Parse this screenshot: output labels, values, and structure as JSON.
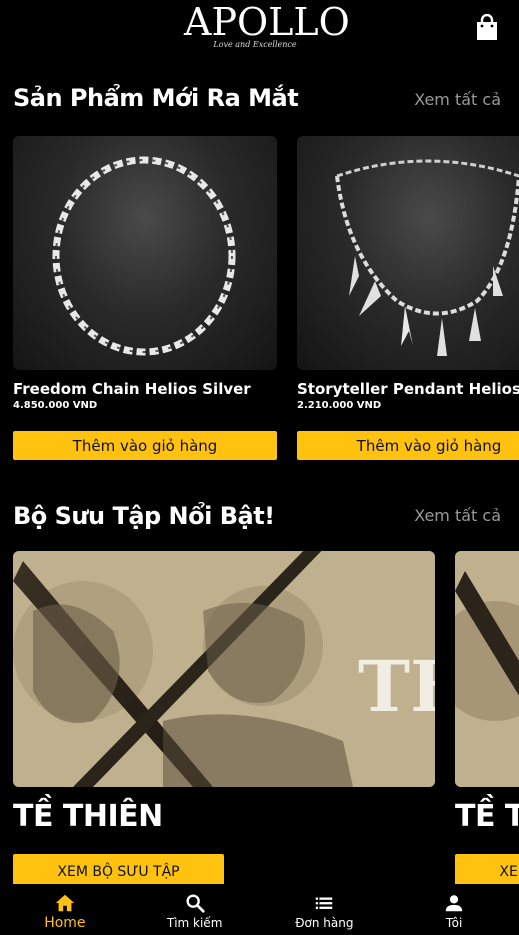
{
  "brand": {
    "name": "APOLLO",
    "tagline": "Love and Excellence"
  },
  "new_products": {
    "title": "Sản Phẩm Mới Ra Mắt",
    "see_all": "Xem tất cả",
    "items": [
      {
        "name": "Freedom Chain Helios Silver",
        "price": "4.850.000 VND",
        "button": "Thêm vào giỏ hàng"
      },
      {
        "name": "Storyteller Pendant Helios Silver",
        "price": "2.210.000 VND",
        "button": "Thêm vào giỏ hàng"
      }
    ]
  },
  "collections": {
    "title": "Bộ Sưu Tập Nổi Bật!",
    "see_all": "Xem tất cả",
    "items": [
      {
        "name": "TỀ THIÊN",
        "button": "XEM BỘ SƯU TẬP",
        "art_text": "TH"
      },
      {
        "name": "TỀ THIÊN",
        "button": "XEM BỘ SƯU TẬP"
      }
    ]
  },
  "bottom_nav": {
    "items": [
      {
        "label": "Home",
        "icon": "home-icon",
        "active": true
      },
      {
        "label": "Tìm kiếm",
        "icon": "search-icon",
        "active": false
      },
      {
        "label": "Đơn hàng",
        "icon": "list-icon",
        "active": false
      },
      {
        "label": "Tôi",
        "icon": "person-icon",
        "active": false
      }
    ]
  },
  "colors": {
    "accent": "#ffc20e",
    "background": "#000000",
    "muted": "#9a9a9a"
  }
}
